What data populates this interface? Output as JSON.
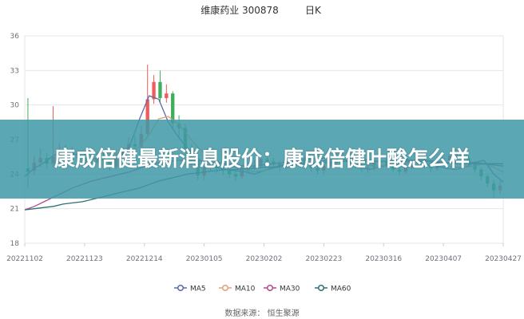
{
  "headline": "康成倍健最新消息股价：康成倍健叶酸怎么样",
  "chart_data": {
    "type": "candlestick",
    "title": "维康药业 300878",
    "period": "日K",
    "source": "数据来源： 恒生聚源",
    "ylim": [
      18,
      36
    ],
    "yticks": [
      18,
      21,
      24,
      27,
      30,
      33,
      36
    ],
    "xlabels": [
      "20221102",
      "20221123",
      "20221214",
      "20230105",
      "20230202",
      "20230223",
      "20230316",
      "20230407",
      "20230427"
    ],
    "series": [
      {
        "name": "MA5",
        "color": "#5b6aa8",
        "values": [
          23.8,
          24.5,
          25.0,
          25.6,
          26.0,
          25.8,
          25.5,
          25.3,
          25.4,
          25.0,
          25.5,
          26.5,
          28.8,
          30.8,
          30.5,
          28.5,
          27.3,
          26.2,
          25.4,
          24.8,
          24.6,
          24.4,
          24.3,
          24.2,
          24.0,
          24.3,
          24.6,
          24.8,
          25.0,
          24.9,
          24.8,
          25.1,
          25.3,
          25.5,
          25.0,
          24.6,
          24.4,
          24.6,
          24.8,
          25.1,
          25.3,
          25.0,
          24.8,
          24.7,
          24.5,
          24.4,
          24.6,
          25.0,
          25.2,
          24.0,
          23.3
        ]
      },
      {
        "name": "MA10",
        "color": "#e3a07a",
        "values": [
          null,
          null,
          null,
          null,
          null,
          null,
          null,
          null,
          null,
          25.6,
          25.4,
          25.8,
          26.4,
          27.4,
          28.8,
          29.0,
          28.4,
          27.4,
          26.4,
          25.6,
          25.1,
          24.8,
          24.6,
          24.4,
          24.2,
          24.3,
          24.5,
          24.7,
          24.8,
          24.9,
          24.9,
          25.0,
          25.1,
          25.2,
          25.1,
          24.9,
          24.8,
          24.7,
          24.8,
          24.9,
          25.0,
          25.0,
          24.9,
          24.8,
          24.7,
          24.6,
          24.6,
          24.7,
          24.9,
          24.6,
          24.2
        ]
      },
      {
        "name": "MA30",
        "color": "#b04a8a",
        "values": [
          20.9,
          21.2,
          21.6,
          22.0,
          22.4,
          22.8,
          23.1,
          23.4,
          23.6,
          23.8,
          24.0,
          24.2,
          24.5,
          24.8,
          25.0,
          25.1,
          25.2,
          25.2,
          25.2,
          25.1,
          25.0,
          24.9,
          24.8,
          24.7,
          24.7,
          24.8,
          24.9,
          25.0,
          25.1,
          25.2,
          25.3,
          25.4,
          25.4,
          25.4,
          25.4,
          25.3,
          25.2,
          25.1,
          25.1,
          25.1,
          25.2,
          25.2,
          25.2,
          25.1,
          25.0,
          24.9,
          24.9,
          24.9,
          24.9,
          24.8,
          24.7
        ]
      },
      {
        "name": "MA60",
        "color": "#2f6f73",
        "values": [
          20.9,
          21.0,
          21.1,
          21.2,
          21.4,
          21.5,
          21.6,
          21.8,
          22.0,
          22.2,
          22.4,
          22.6,
          22.8,
          23.1,
          23.4,
          23.6,
          23.8,
          24.0,
          24.1,
          24.2,
          24.3,
          24.4,
          24.4,
          24.5,
          24.5,
          24.6,
          24.6,
          24.7,
          24.8,
          24.9,
          24.9,
          25.0,
          25.0,
          25.1,
          25.1,
          25.1,
          25.1,
          25.1,
          25.1,
          25.1,
          25.1,
          25.1,
          25.1,
          25.0,
          25.0,
          25.0,
          25.0,
          25.0,
          24.9,
          24.9,
          24.9
        ]
      }
    ],
    "candles": [
      [
        24.5,
        24.2,
        30.6,
        22.8
      ],
      [
        24.3,
        25.0,
        25.6,
        23.9
      ],
      [
        25.0,
        25.4,
        26.2,
        24.6
      ],
      [
        25.4,
        24.9,
        25.8,
        24.5
      ],
      [
        24.9,
        25.5,
        29.9,
        24.6
      ],
      [
        25.5,
        26.1,
        26.7,
        25.2
      ],
      [
        26.1,
        25.7,
        26.5,
        25.3
      ],
      [
        25.7,
        25.9,
        26.4,
        25.4
      ],
      [
        25.9,
        25.4,
        26.0,
        25.0
      ],
      [
        25.4,
        25.1,
        25.8,
        24.8
      ],
      [
        25.1,
        25.0,
        25.6,
        24.7
      ],
      [
        25.0,
        25.4,
        25.9,
        24.9
      ],
      [
        25.4,
        25.2,
        25.9,
        24.6
      ],
      [
        25.2,
        24.6,
        25.5,
        24.3
      ],
      [
        24.6,
        25.4,
        26.0,
        24.4
      ],
      [
        25.4,
        25.9,
        26.3,
        25.2
      ],
      [
        25.9,
        26.6,
        27.2,
        25.7
      ],
      [
        26.6,
        26.4,
        27.4,
        26.0
      ],
      [
        26.4,
        27.5,
        28.2,
        26.3
      ],
      [
        27.5,
        30.5,
        33.5,
        27.3
      ],
      [
        30.5,
        32.0,
        32.6,
        30.1
      ],
      [
        32.0,
        30.6,
        33.0,
        30.2
      ],
      [
        30.6,
        31.0,
        31.8,
        30.2
      ],
      [
        31.0,
        28.4,
        31.2,
        28.0
      ],
      [
        28.4,
        28.0,
        29.1,
        27.3
      ],
      [
        28.0,
        26.2,
        28.4,
        25.6
      ],
      [
        26.2,
        25.3,
        26.6,
        24.8
      ],
      [
        25.3,
        23.9,
        25.6,
        23.5
      ],
      [
        23.9,
        24.6,
        25.0,
        23.5
      ],
      [
        24.6,
        24.9,
        25.3,
        24.2
      ],
      [
        24.9,
        24.5,
        25.4,
        24.1
      ],
      [
        24.5,
        24.3,
        24.9,
        23.9
      ],
      [
        24.3,
        24.0,
        24.7,
        23.7
      ],
      [
        24.0,
        23.8,
        24.4,
        23.4
      ],
      [
        23.8,
        24.4,
        24.8,
        23.6
      ],
      [
        24.4,
        24.6,
        25.0,
        24.1
      ],
      [
        24.6,
        24.8,
        25.2,
        24.4
      ],
      [
        24.8,
        25.3,
        25.6,
        24.6
      ],
      [
        25.3,
        25.1,
        25.6,
        24.8
      ],
      [
        25.1,
        24.9,
        25.4,
        24.6
      ],
      [
        24.9,
        24.6,
        25.2,
        24.2
      ],
      [
        24.6,
        25.5,
        25.9,
        24.4
      ],
      [
        25.5,
        25.8,
        26.2,
        25.3
      ],
      [
        25.8,
        25.4,
        26.0,
        25.1
      ],
      [
        25.4,
        24.8,
        25.6,
        24.5
      ],
      [
        24.8,
        24.5,
        25.1,
        24.2
      ],
      [
        24.5,
        24.3,
        24.8,
        24.0
      ],
      [
        24.3,
        24.7,
        25.0,
        24.0
      ],
      [
        24.7,
        25.0,
        25.4,
        24.5
      ],
      [
        25.0,
        25.4,
        25.8,
        24.8
      ],
      [
        25.4,
        25.6,
        26.0,
        25.2
      ],
      [
        25.6,
        25.3,
        25.9,
        25.0
      ],
      [
        25.3,
        24.8,
        25.5,
        24.5
      ],
      [
        24.8,
        24.5,
        25.1,
        24.2
      ],
      [
        24.5,
        24.6,
        24.9,
        24.1
      ],
      [
        24.6,
        25.0,
        25.3,
        24.3
      ],
      [
        25.0,
        25.1,
        25.6,
        24.8
      ],
      [
        25.1,
        24.8,
        25.4,
        24.6
      ],
      [
        24.8,
        24.4,
        25.0,
        24.2
      ],
      [
        24.4,
        24.2,
        24.7,
        23.9
      ],
      [
        24.2,
        24.6,
        24.9,
        24.0
      ],
      [
        24.6,
        24.9,
        25.2,
        24.4
      ],
      [
        24.9,
        25.0,
        25.3,
        24.6
      ],
      [
        25.0,
        24.7,
        25.2,
        24.5
      ],
      [
        24.7,
        24.5,
        24.9,
        24.2
      ],
      [
        24.5,
        24.8,
        25.1,
        24.3
      ],
      [
        24.8,
        25.2,
        25.5,
        24.6
      ],
      [
        25.2,
        25.6,
        26.0,
        25.0
      ],
      [
        25.6,
        25.8,
        26.2,
        25.4
      ],
      [
        25.8,
        25.4,
        26.0,
        25.1
      ],
      [
        25.4,
        24.9,
        25.6,
        24.6
      ],
      [
        24.9,
        24.4,
        25.1,
        24.1
      ],
      [
        24.4,
        23.8,
        24.6,
        23.5
      ],
      [
        23.8,
        23.2,
        24.0,
        22.9
      ],
      [
        23.2,
        22.6,
        23.5,
        22.0
      ],
      [
        22.6,
        23.0,
        23.4,
        22.3
      ]
    ]
  }
}
